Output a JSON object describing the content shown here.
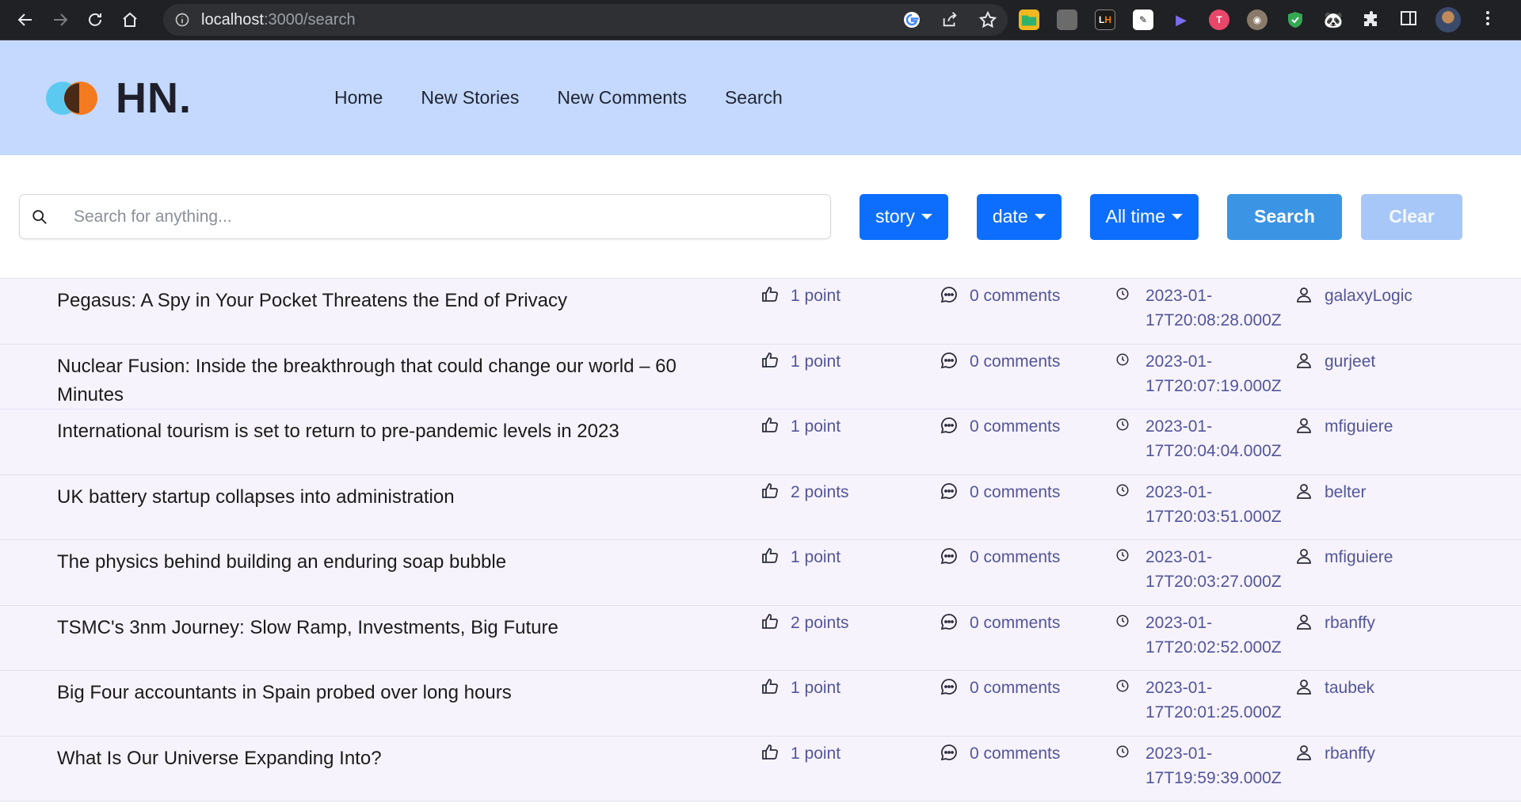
{
  "browser": {
    "url_host": "localhost",
    "url_path": ":3000/search"
  },
  "site": {
    "logo_text": "HN.",
    "nav": [
      {
        "label": "Home"
      },
      {
        "label": "New Stories"
      },
      {
        "label": "New Comments"
      },
      {
        "label": "Search"
      }
    ]
  },
  "search": {
    "placeholder": "Search for anything...",
    "type_filter": "story",
    "sort_filter": "date",
    "range_filter": "All time",
    "search_label": "Search",
    "clear_label": "Clear"
  },
  "results": [
    {
      "title": "Pegasus: A Spy in Your Pocket Threatens the End of Privacy",
      "points": "1 point",
      "comments": "0 comments",
      "time": "2023-01-17T20:08:28.000Z",
      "author": "galaxyLogic"
    },
    {
      "title": "Nuclear Fusion: Inside the breakthrough that could change our world – 60 Minutes",
      "points": "1 point",
      "comments": "0 comments",
      "time": "2023-01-17T20:07:19.000Z",
      "author": "gurjeet"
    },
    {
      "title": "International tourism is set to return to pre-pandemic levels in 2023",
      "points": "1 point",
      "comments": "0 comments",
      "time": "2023-01-17T20:04:04.000Z",
      "author": "mfiguiere"
    },
    {
      "title": "UK battery startup collapses into administration",
      "points": "2 points",
      "comments": "0 comments",
      "time": "2023-01-17T20:03:51.000Z",
      "author": "belter"
    },
    {
      "title": "The physics behind building an enduring soap bubble",
      "points": "1 point",
      "comments": "0 comments",
      "time": "2023-01-17T20:03:27.000Z",
      "author": "mfiguiere"
    },
    {
      "title": "TSMC's 3nm Journey: Slow Ramp, Investments, Big Future",
      "points": "2 points",
      "comments": "0 comments",
      "time": "2023-01-17T20:02:52.000Z",
      "author": "rbanffy"
    },
    {
      "title": "Big Four accountants in Spain probed over long hours",
      "points": "1 point",
      "comments": "0 comments",
      "time": "2023-01-17T20:01:25.000Z",
      "author": "taubek"
    },
    {
      "title": "What Is Our Universe Expanding Into?",
      "points": "1 point",
      "comments": "0 comments",
      "time": "2023-01-17T19:59:39.000Z",
      "author": "rbanffy"
    }
  ]
}
